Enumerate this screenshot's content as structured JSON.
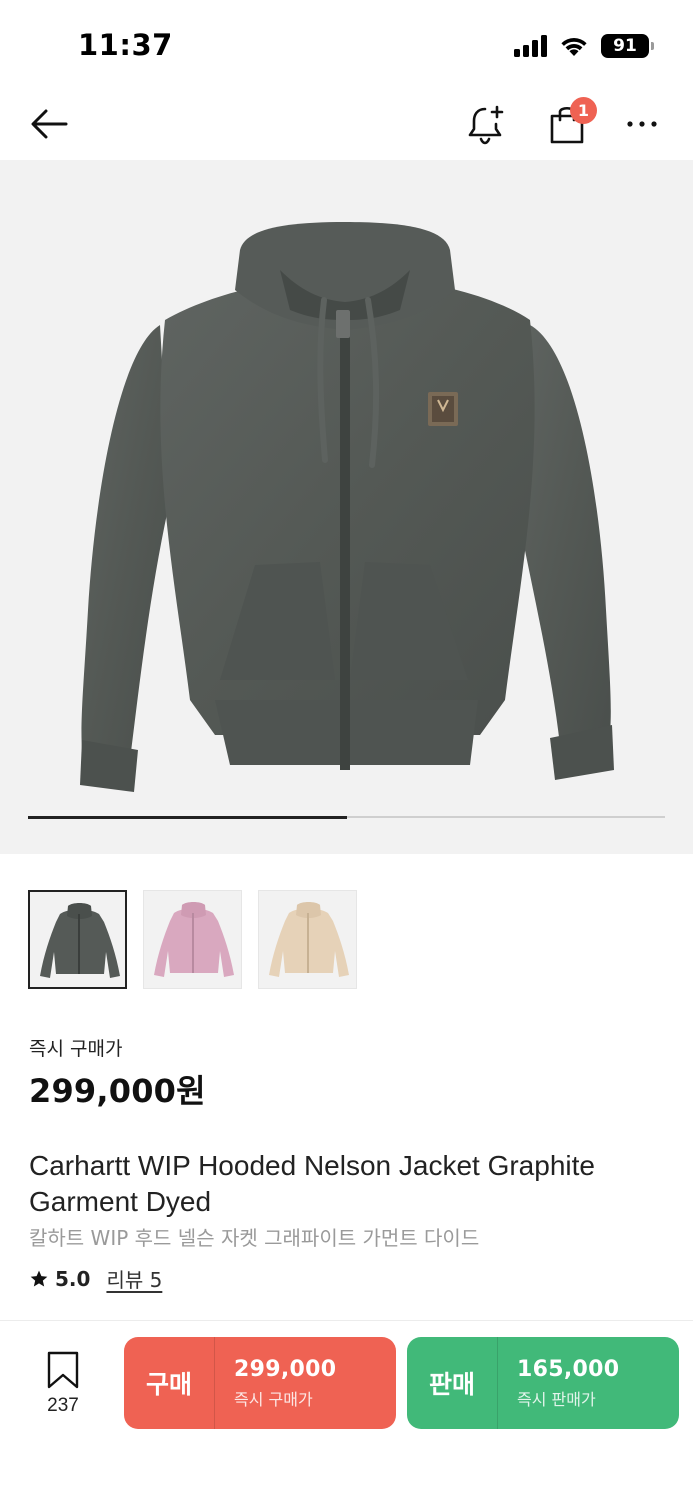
{
  "status_bar": {
    "time": "11:37",
    "battery": "91",
    "icons": [
      "signal-icon",
      "wifi-icon",
      "battery-icon"
    ]
  },
  "nav": {
    "icons": [
      "back-arrow-icon",
      "bell-plus-icon",
      "shopping-bag-icon",
      "more-icon"
    ],
    "cart_badge": "1"
  },
  "gallery": {
    "progress": 0.5,
    "colors": {
      "graphite": "#555a57",
      "pink": "#d9a8bf",
      "beige": "#e6d2b8"
    },
    "thumbnails": [
      {
        "name": "graphite",
        "selected": true
      },
      {
        "name": "pink",
        "selected": false
      },
      {
        "name": "beige",
        "selected": false
      }
    ]
  },
  "price": {
    "label": "즉시 구매가",
    "value": "299,000원"
  },
  "product": {
    "title_en": "Carhartt WIP Hooded Nelson Jacket Graphite Garment Dyed",
    "title_ko": "칼하트 WIP 후드 넬슨 자켓 그래파이트 가먼트 다이드",
    "rating": "5.0",
    "review_label": "리뷰 5"
  },
  "bottom": {
    "bookmark_count": "237",
    "buy": {
      "label": "구매",
      "price": "299,000",
      "sub": "즉시 구매가",
      "color": "#ef6253"
    },
    "sell": {
      "label": "판매",
      "price": "165,000",
      "sub": "즉시 판매가",
      "color": "#41b979"
    }
  }
}
